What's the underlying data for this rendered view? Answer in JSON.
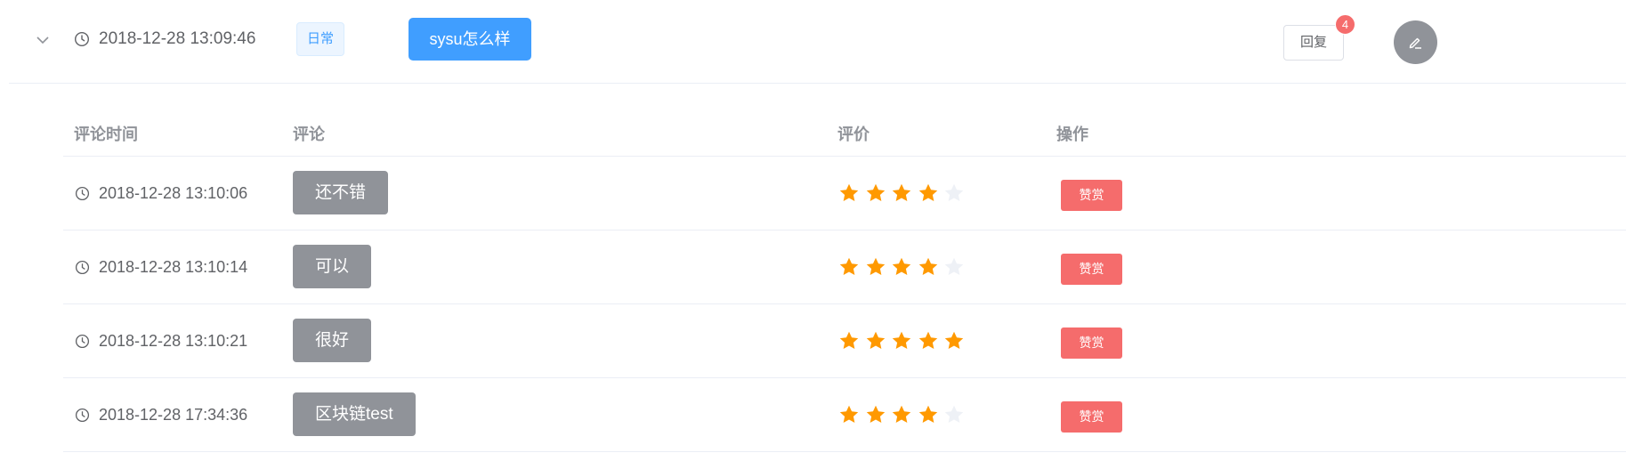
{
  "post": {
    "time": "2018-12-28 13:09:46",
    "tag": "日常",
    "title": "sysu怎么样",
    "reply_label": "回复",
    "reply_count": "4",
    "icons": {
      "expand": "chevron-down-icon",
      "time": "clock-icon",
      "edit": "edit-pen-icon"
    }
  },
  "comments_table": {
    "headers": {
      "time": "评论时间",
      "comment": "评论",
      "rating": "评价",
      "action": "操作"
    },
    "max_rating": 5,
    "rows": [
      {
        "time": "2018-12-28 13:10:06",
        "comment": "还不错",
        "rating": 4,
        "action_label": "赞赏"
      },
      {
        "time": "2018-12-28 13:10:14",
        "comment": "可以",
        "rating": 4,
        "action_label": "赞赏"
      },
      {
        "time": "2018-12-28 13:10:21",
        "comment": "很好",
        "rating": 5,
        "action_label": "赞赏"
      },
      {
        "time": "2018-12-28 17:34:36",
        "comment": "区块链test",
        "rating": 4,
        "action_label": "赞赏"
      }
    ]
  },
  "colors": {
    "primary": "#409eff",
    "danger": "#f56c6c",
    "info": "#909399",
    "star_on": "#f7ba2a",
    "star_on_display": "#ff9900",
    "star_off": "#eef1f6"
  }
}
